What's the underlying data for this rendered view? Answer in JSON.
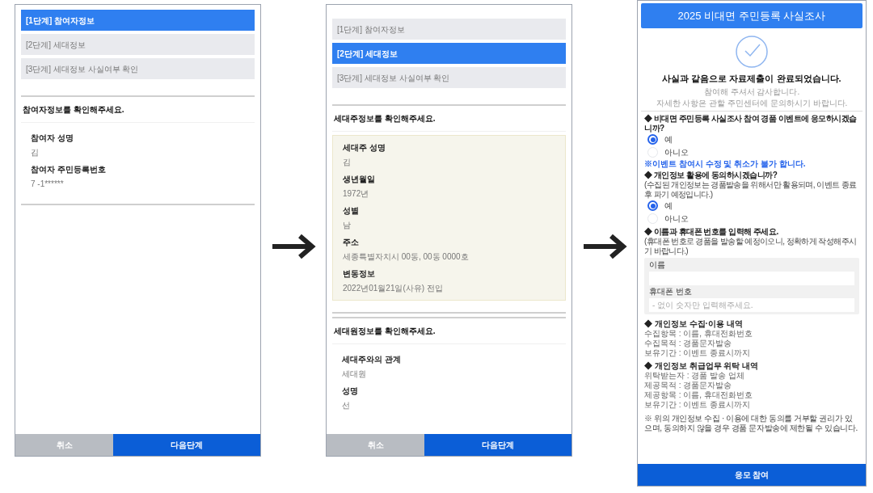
{
  "screens": [
    {
      "kind": "steps",
      "steps": [
        {
          "label": "[1단계] 참여자정보",
          "selected": true
        },
        {
          "label": "[2단계] 세대정보",
          "selected": false
        },
        {
          "label": "[3단계] 세대정보 사실여부 확인",
          "selected": false
        }
      ],
      "sections": [
        {
          "heading": "참여자정보를 확인해주세요.",
          "highlighted": false,
          "fields": [
            {
              "label": "참여자 성명",
              "value": "김"
            },
            {
              "label": "참여자 주민등록번호",
              "value": "7 -1******"
            }
          ]
        }
      ],
      "buttons": [
        {
          "label": "취소",
          "kind": "cancel"
        },
        {
          "label": "다음단계",
          "kind": "primary"
        }
      ]
    },
    {
      "kind": "steps",
      "steps": [
        {
          "label": "[1단계] 참여자정보",
          "selected": false
        },
        {
          "label": "[2단계] 세대정보",
          "selected": true
        },
        {
          "label": "[3단계] 세대정보 사실여부 확인",
          "selected": false
        }
      ],
      "sections": [
        {
          "heading": "세대주정보를 확인해주세요.",
          "highlighted": true,
          "fields": [
            {
              "label": "세대주 성명",
              "value": "김"
            },
            {
              "label": "생년월일",
              "value": "1972년"
            },
            {
              "label": "성별",
              "value": "남"
            },
            {
              "label": "주소",
              "value": "세종특별자치시 00동, 00동 0000호"
            },
            {
              "label": "변동정보",
              "value": "2022년01월21일(사유) 전입"
            }
          ]
        },
        {
          "heading": "세대원정보를 확인해주세요.",
          "highlighted": false,
          "fields": [
            {
              "label": "세대주와의 관계",
              "value": "세대원"
            },
            {
              "label": "성명",
              "value": "선"
            }
          ]
        }
      ],
      "buttons": [
        {
          "label": "취소",
          "kind": "cancel"
        },
        {
          "label": "다음단계",
          "kind": "primary"
        }
      ]
    },
    {
      "kind": "result",
      "header": "2025 비대면 주민등록 사실조사",
      "title": "사실과 같음으로 자료제출이 완료되었습니다.",
      "messages": [
        "참여해 주셔서 감사합니다.",
        "자세한 사항은 관할 주민센터에 문의하시기 바랍니다."
      ],
      "questions": [
        {
          "text": "◆ 비대면 주민등록 사실조사 참여 경품 이벤트에 응모하시겠습니까?",
          "options": [
            {
              "label": "예",
              "selected": true
            },
            {
              "label": "아니오",
              "selected": false
            }
          ],
          "warning": "※이벤트 참여시 수정 및 취소가 불가 합니다."
        },
        {
          "text": "◆ 개인정보 활용에 동의하시겠습니까?",
          "note": "(수집된 개인정보는 경품발송을 위해서만 활용되며, 이벤트 종료 후 파기 예정입니다.)",
          "options": [
            {
              "label": "예",
              "selected": true
            },
            {
              "label": "아니오",
              "selected": false
            }
          ]
        },
        {
          "text": "◆ 이름과 휴대폰 번호를 입력해 주세요.",
          "note": "(휴대폰 번호로 경품을 발송할 예정이오니, 정확하게 작성해주시기 바랍니다.)",
          "fields": [
            {
              "label": "이름"
            },
            {
              "label": "휴대폰 번호",
              "placeholder": "- 없이 숫자만 입력해주세요."
            }
          ]
        }
      ],
      "details": [
        {
          "heading": "◆ 개인정보 수집·이용 내역",
          "lines": [
            "수집항목 : 이름, 휴대전화번호",
            "수집목적 : 경품문자발송",
            "보유기간 : 이벤트 종료시까지"
          ]
        },
        {
          "heading": "◆ 개인정보 취급업무 위탁 내역",
          "lines": [
            "위탁받는자 : 경품 발송 업체",
            "제공목적 : 경품문자발송",
            "제공항목 : 이름, 휴대전화번호",
            "보유기간 : 이벤트 종료시까지"
          ]
        }
      ],
      "footnote": "※ 위의 개인정보 수집 · 이용에 대한 동의를 거부할 권리가 있으며, 동의하지 않을 경우 경품 문자발송에 제한될 수 있습니다.",
      "button": "응모 참여"
    }
  ]
}
